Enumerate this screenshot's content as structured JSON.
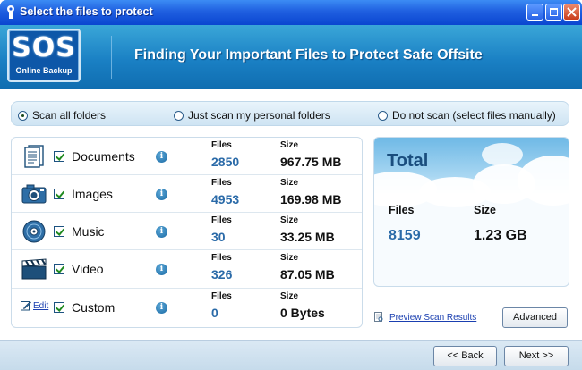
{
  "window": {
    "title": "Select the files to protect"
  },
  "header": {
    "logo_main": "SOS",
    "logo_sub": "Online Backup",
    "title": "Finding Your Important Files to Protect Safe Offsite"
  },
  "scan_options": [
    {
      "label": "Scan all folders",
      "selected": true
    },
    {
      "label": "Just scan my personal folders",
      "selected": false
    },
    {
      "label": "Do not scan (select files manually)",
      "selected": false
    }
  ],
  "column_headers": {
    "files": "Files",
    "size": "Size"
  },
  "categories": [
    {
      "label": "Documents",
      "icon": "documents-icon",
      "checked": true,
      "files": "2850",
      "size": "967.75 MB"
    },
    {
      "label": "Images",
      "icon": "camera-icon",
      "checked": true,
      "files": "4953",
      "size": "169.98 MB"
    },
    {
      "label": "Music",
      "icon": "music-disc-icon",
      "checked": true,
      "files": "30",
      "size": "33.25 MB"
    },
    {
      "label": "Video",
      "icon": "clapperboard-icon",
      "checked": true,
      "files": "326",
      "size": "87.05 MB"
    },
    {
      "label": "Custom",
      "icon": "edit-icon",
      "checked": true,
      "files": "0",
      "size": "0 Bytes",
      "edit_label": "Edit"
    }
  ],
  "total": {
    "title": "Total",
    "files_label": "Files",
    "size_label": "Size",
    "files": "8159",
    "size": "1.23 GB"
  },
  "preview_link": "Preview Scan Results",
  "buttons": {
    "advanced": "Advanced",
    "back": "<< Back",
    "next": "Next >>"
  },
  "colors": {
    "titlebar": "#0a46d0",
    "header": "#1a80c4",
    "value_blue": "#2a6aa8"
  }
}
